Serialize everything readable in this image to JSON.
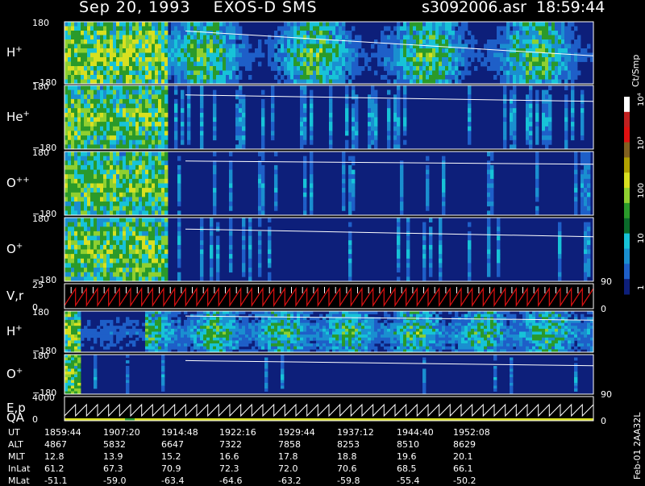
{
  "header": {
    "date": "Sep 20, 1993",
    "mission": "EXOS-D SMS",
    "file": "s3092006.asr",
    "time": "18:59:44"
  },
  "colorbar": {
    "unit": "Ct/Smp",
    "ticks": [
      "10⁴",
      "10³",
      "100",
      "10",
      "1"
    ]
  },
  "ephemeris": {
    "rows": [
      {
        "label": "UT",
        "values": [
          "1859:44",
          "1907:20",
          "1914:48",
          "1922:16",
          "1929:44",
          "1937:12",
          "1944:40",
          "1952:08"
        ]
      },
      {
        "label": "ALT",
        "values": [
          "4867",
          "5832",
          "6647",
          "7322",
          "7858",
          "8253",
          "8510",
          "8629"
        ]
      },
      {
        "label": "MLT",
        "values": [
          "12.8",
          "13.9",
          "15.2",
          "16.6",
          "17.8",
          "18.8",
          "19.6",
          "20.1"
        ]
      },
      {
        "label": "InLat",
        "values": [
          "61.2",
          "67.3",
          "70.9",
          "72.3",
          "72.0",
          "70.6",
          "68.5",
          "66.1"
        ]
      },
      {
        "label": "MLat",
        "values": [
          "-51.1",
          "-59.0",
          "-63.4",
          "-64.6",
          "-63.2",
          "-59.8",
          "-55.4",
          "-50.2"
        ]
      }
    ]
  },
  "side_note": "Feb-01 2AA32L",
  "chart_data": {
    "type": "heatmap",
    "panels": [
      {
        "label": "H",
        "sup": "+",
        "yticks": [
          "180",
          "−180"
        ],
        "right_tick": ""
      },
      {
        "label": "He",
        "sup": "+",
        "yticks": [
          "180",
          "−180"
        ],
        "right_tick": ""
      },
      {
        "label": "O",
        "sup": "++",
        "yticks": [
          "180",
          "−180"
        ],
        "right_tick": ""
      },
      {
        "label": "O",
        "sup": "+",
        "yticks": [
          "180",
          "−180"
        ],
        "right_tick": "90"
      },
      {
        "label": "V,r",
        "sup": "",
        "yticks": [
          "25",
          "0"
        ],
        "right_tick": "0"
      },
      {
        "label": "H",
        "sup": "+",
        "yticks": [
          "180",
          "−180"
        ],
        "right_tick": ""
      },
      {
        "label": "O",
        "sup": "+",
        "yticks": [
          "180",
          "−180"
        ],
        "right_tick": "90"
      },
      {
        "label": "E,p",
        "sup": "",
        "yticks": [
          "4000",
          "0"
        ],
        "right_tick": "0"
      }
    ],
    "qa_label": "QA",
    "x_ticks": [
      "1859:44",
      "1907:20",
      "1914:48",
      "1922:16",
      "1929:44",
      "1937:12",
      "1944:40",
      "1952:08"
    ],
    "colors": {
      "background": "#0d1f7a",
      "low": "#1e5fc8",
      "cyan": "#17c3d8",
      "green": "#2a9a2a",
      "yellow": "#d8e020",
      "red": "#e01010",
      "white": "#ffffff"
    }
  }
}
